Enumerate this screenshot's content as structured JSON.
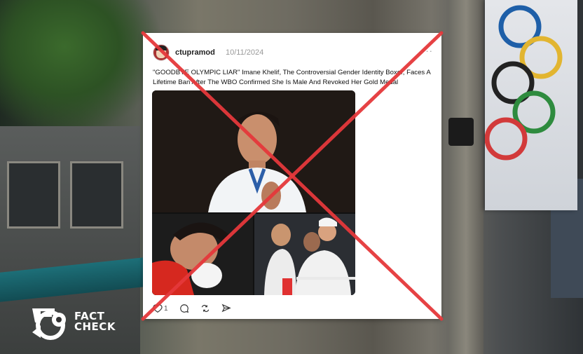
{
  "post": {
    "username": "ctupramod",
    "date": "10/11/2024",
    "menu": "···",
    "text": "\"GOODBYE OLYMPIC LIAR\" Imane Khelif, The Controversial Gender Identity Boxer, Faces A Lifetime Ban After The WBO Confirmed She Is Male And Revoked Her Gold Medal",
    "like_count": "1"
  },
  "icons": {
    "avatar": "avatar",
    "like": "heart-icon",
    "comment": "comment-icon",
    "repost": "repost-icon",
    "share": "send-icon"
  },
  "overlay": {
    "cross_color": "#e5383b"
  },
  "logo": {
    "brand_line1": "FACT",
    "brand_line2": "CHECK"
  }
}
